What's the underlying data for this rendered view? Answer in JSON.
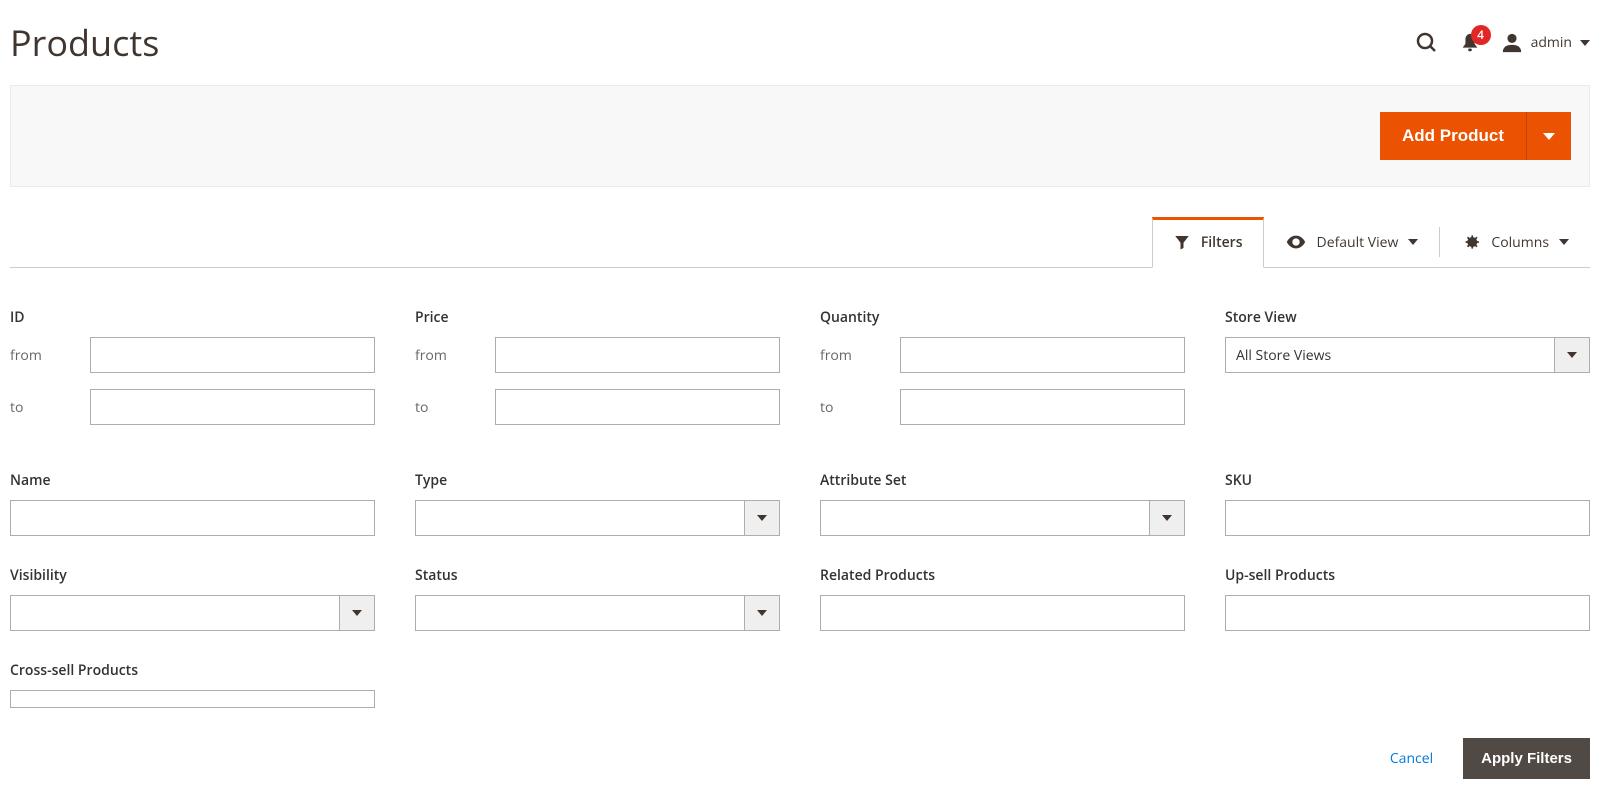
{
  "header": {
    "title": "Products",
    "notification_count": "4",
    "username": "admin"
  },
  "action_bar": {
    "add_product_label": "Add Product"
  },
  "toolbar": {
    "filters_label": "Filters",
    "default_view_label": "Default View",
    "columns_label": "Columns"
  },
  "filters": {
    "id": {
      "label": "ID",
      "from_label": "from",
      "to_label": "to",
      "from_value": "",
      "to_value": ""
    },
    "price": {
      "label": "Price",
      "from_label": "from",
      "to_label": "to",
      "from_value": "",
      "to_value": ""
    },
    "quantity": {
      "label": "Quantity",
      "from_label": "from",
      "to_label": "to",
      "from_value": "",
      "to_value": ""
    },
    "store_view": {
      "label": "Store View",
      "value": "All Store Views"
    },
    "name": {
      "label": "Name",
      "value": ""
    },
    "type": {
      "label": "Type",
      "value": ""
    },
    "attribute_set": {
      "label": "Attribute Set",
      "value": ""
    },
    "sku": {
      "label": "SKU",
      "value": ""
    },
    "visibility": {
      "label": "Visibility",
      "value": ""
    },
    "status": {
      "label": "Status",
      "value": ""
    },
    "related": {
      "label": "Related Products",
      "value": ""
    },
    "upsell": {
      "label": "Up-sell Products",
      "value": ""
    },
    "crosssell": {
      "label": "Cross-sell Products",
      "value": ""
    }
  },
  "footer": {
    "cancel_label": "Cancel",
    "apply_label": "Apply Filters"
  }
}
